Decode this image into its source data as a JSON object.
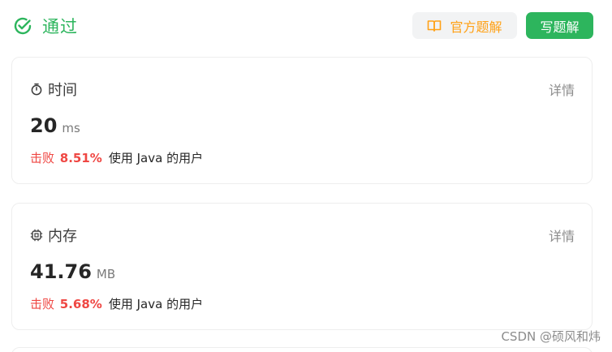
{
  "status": {
    "label": "通过",
    "color": "#2db55d",
    "icon": "check-circle-icon"
  },
  "actions": {
    "official_solution_label": "官方题解",
    "official_solution_icon": "book-icon",
    "write_solution_label": "写题解"
  },
  "runtime": {
    "title": "时间",
    "icon": "stopwatch-icon",
    "detail_label": "详情",
    "value": "20",
    "unit": "ms",
    "beat_prefix": "击败",
    "beat_percent": "8.51%",
    "beat_suffix": "使用 Java 的用户"
  },
  "memory": {
    "title": "内存",
    "icon": "chip-icon",
    "detail_label": "详情",
    "value": "41.76",
    "unit": "MB",
    "beat_prefix": "击败",
    "beat_percent": "5.68%",
    "beat_suffix": "使用 Java 的用户"
  },
  "watermark": "CSDN @硕风和炜",
  "colors": {
    "accent_green": "#2db55d",
    "accent_orange": "#ffa116",
    "beat_red": "#ef4743"
  }
}
